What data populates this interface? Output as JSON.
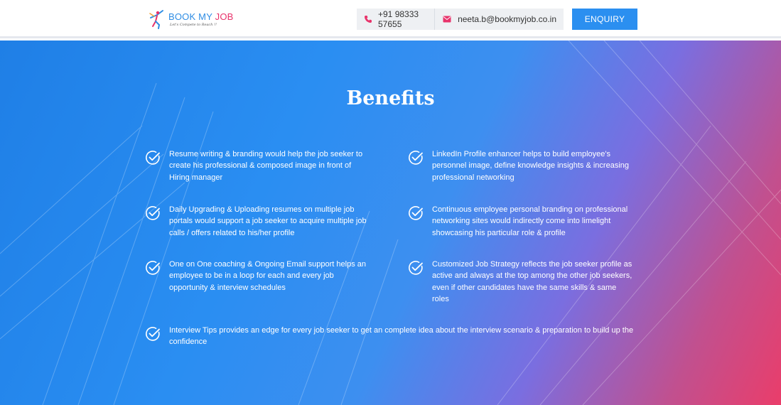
{
  "header": {
    "logo": {
      "name_part1": "BOOK MY ",
      "name_part2": "JOB",
      "tagline": "Let's Compete to Reach !!"
    },
    "phone": "+91 98333 57655",
    "email": "neeta.b@bookmyjob.co.in",
    "enquiry_label": "ENQUIRY"
  },
  "benefits": {
    "title": "Benefits",
    "items": [
      {
        "text": "Resume writing & branding would help the job seeker to create his professional & composed image in front of Hiring manager"
      },
      {
        "text": "LinkedIn Profile enhancer helps to build employee's personnel image, define knowledge insights & increasing professional networking"
      },
      {
        "text": "Daily Upgrading & Uploading resumes on multiple job portals would support a job seeker to acquire multiple job calls / offers related to his/her profile"
      },
      {
        "text": "Continuous employee personal branding on professional networking sites would indirectly come into limelight showcasing his particular role & profile"
      },
      {
        "text": "One on One coaching & Ongoing Email support helps an employee to be in a loop for each and every job opportunity & interview schedules"
      },
      {
        "text": "Customized Job Strategy reflects the job seeker profile as active and always at the top among the other job seekers, even if other candidates have the same skills & same roles"
      },
      {
        "text": "Interview Tips provides an edge for every job seeker to get an complete idea about the interview scenario & preparation to build up the confidence"
      }
    ]
  },
  "icons": {
    "phone": "phone-icon",
    "email": "envelope-icon",
    "check": "check-circle-icon"
  },
  "colors": {
    "primary": "#2b8ff0",
    "accent": "#e8336b"
  }
}
